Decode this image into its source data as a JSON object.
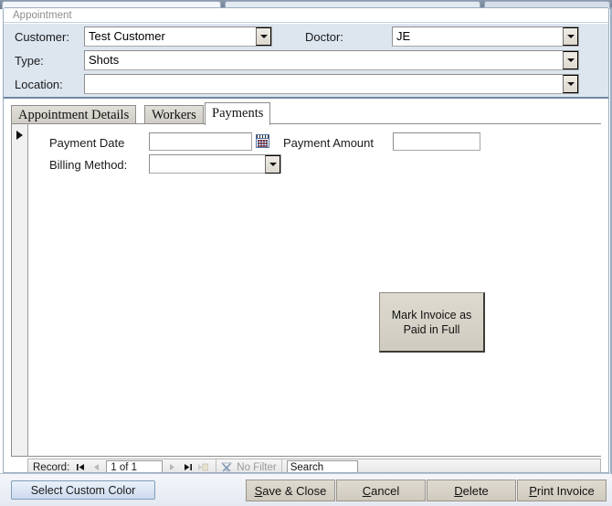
{
  "window": {
    "caption": "Appointment"
  },
  "doc_tabs": [
    "",
    "",
    ""
  ],
  "header": {
    "fields": [
      {
        "label": "Customer:",
        "value": "Test Customer",
        "type": "combo"
      },
      {
        "label": "Doctor:",
        "value": "JE",
        "type": "combo"
      },
      {
        "label": "Type:",
        "value": "Shots",
        "type": "combo"
      },
      {
        "label": "Location:",
        "value": "",
        "type": "combo"
      }
    ]
  },
  "tabs": [
    {
      "label": "Appointment Details",
      "active": false
    },
    {
      "label": "Workers",
      "active": false
    },
    {
      "label": "Payments",
      "active": true
    }
  ],
  "payments": {
    "payment_date_label": "Payment Date",
    "payment_date_value": "",
    "payment_amount_label": "Payment Amount",
    "payment_amount_value": "",
    "billing_method_label": "Billing Method:",
    "billing_method_value": "",
    "mark_invoice_button": "Mark Invoice as\nPaid in Full",
    "mark_invoice_line1": "Mark Invoice as",
    "mark_invoice_line2": "Paid in Full",
    "calendar_icon": "calendar-icon"
  },
  "navigation": {
    "record_label": "Record:",
    "position": "1 of 1",
    "first_icon": "first-record-icon",
    "prev_icon": "previous-record-icon",
    "next_icon": "next-record-icon",
    "last_icon": "last-record-icon",
    "new_icon": "new-record-icon",
    "filter_status": "No Filter",
    "filter_icon": "filter-icon",
    "search_value": "Search",
    "search_placeholder": "Search"
  },
  "footer": {
    "select_custom_color": "Select Custom Color",
    "buttons": [
      {
        "accel": "S",
        "rest": "ave & Close"
      },
      {
        "accel": "C",
        "rest": "ancel"
      },
      {
        "accel": "D",
        "rest": "elete"
      },
      {
        "accel": "P",
        "rest": "rint Invoice"
      }
    ]
  },
  "colors": {
    "header_band": "#dde5ef",
    "header_rule": "#6f86a6",
    "tab_active": "#ffffff",
    "tab_inactive": "#d6d3cc",
    "button_tan": "#d6d1c5",
    "button_blue": "#dbe5f2",
    "doc_tab_strip": "#7b8aa0"
  }
}
